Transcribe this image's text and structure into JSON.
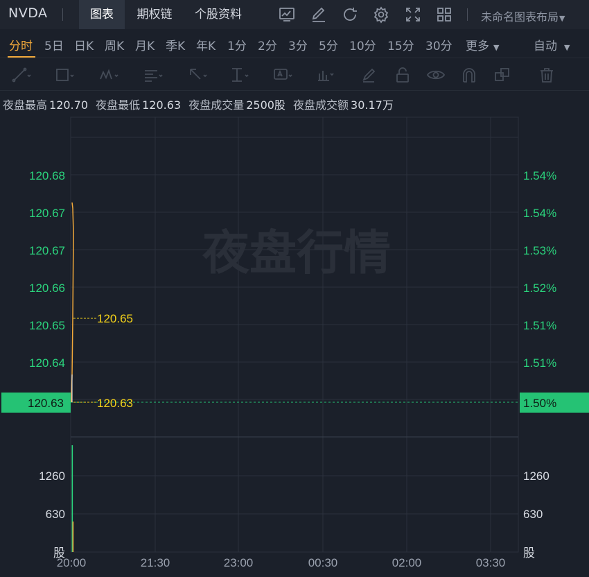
{
  "header": {
    "ticker": "NVDA",
    "tabs": [
      {
        "label": "图表",
        "active": true
      },
      {
        "label": "期权链",
        "active": false
      },
      {
        "label": "个股资料",
        "active": false
      }
    ],
    "toolbar_icons": [
      "chart-icon",
      "edit-icon",
      "refresh-icon",
      "settings-icon",
      "fullscreen-icon",
      "grid-icon"
    ],
    "layout_name": "未命名图表布局"
  },
  "periods": {
    "items": [
      "分时",
      "5日",
      "日K",
      "周K",
      "月K",
      "季K",
      "年K",
      "1分",
      "2分",
      "3分",
      "5分",
      "10分",
      "15分",
      "30分",
      "更多"
    ],
    "active": "分时",
    "scale_mode": "自动"
  },
  "tools": [
    "line-tool-icon",
    "rect-tool-icon",
    "pattern-tool-icon",
    "fib-tool-icon",
    "arrow-tool-icon",
    "measure-tool-icon",
    "text-tool-icon",
    "indicator-tool-icon",
    "pen-tool-icon",
    "lock-icon",
    "eye-icon",
    "magnet-icon",
    "layers-icon",
    "trash-icon"
  ],
  "stats": [
    {
      "label": "夜盘最高",
      "value": "120.70"
    },
    {
      "label": "夜盘最低",
      "value": "120.63"
    },
    {
      "label": "夜盘成交量",
      "value": "2500股"
    },
    {
      "label": "夜盘成交额",
      "value": "30.17万"
    }
  ],
  "chart": {
    "watermark": "夜盘行情",
    "price_ticks_left": [
      "120.68",
      "120.67",
      "120.67",
      "120.66",
      "120.65",
      "120.64"
    ],
    "pct_ticks_right": [
      "1.54%",
      "1.54%",
      "1.53%",
      "1.52%",
      "1.51%",
      "1.51%"
    ],
    "current_price": "120.63",
    "current_pct": "1.50%",
    "marker_high": "120.65",
    "marker_last": "120.63",
    "volume_ticks": [
      "1260",
      "630"
    ],
    "volume_unit": "股",
    "time_ticks": [
      "20:00",
      "21:30",
      "23:00",
      "00:30",
      "02:00",
      "03:30"
    ],
    "colors": {
      "up": "#2bd47d",
      "down": "#f2a93b",
      "price_label_bg": "#25c274",
      "marker": "#f5d31a",
      "grid": "#2b313c"
    }
  }
}
